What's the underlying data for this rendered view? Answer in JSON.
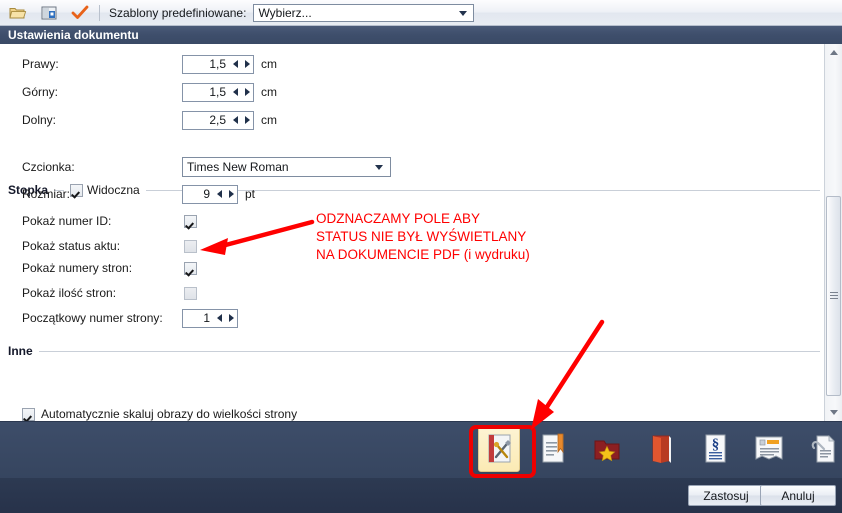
{
  "toolbar": {
    "icons": [
      {
        "name": "open-folder-icon"
      },
      {
        "name": "save-disk-icon"
      },
      {
        "name": "apply-check-icon"
      }
    ],
    "templates_label": "Szablony predefiniowane:",
    "templates_value": "Wybierz...",
    "templates_placeholder": "Wybierz..."
  },
  "header": {
    "title": "Ustawienia dokumentu"
  },
  "margins": [
    {
      "label": "Prawy:",
      "value": "1,5",
      "unit": "cm"
    },
    {
      "label": "Górny:",
      "value": "1,5",
      "unit": "cm"
    },
    {
      "label": "Dolny:",
      "value": "2,5",
      "unit": "cm"
    }
  ],
  "footer_group": {
    "title": "Stopka",
    "visible_label": "Widoczna",
    "visible_checked": true,
    "font_label": "Czcionka:",
    "font_value": "Times New Roman",
    "size_label": "Rozmiar:",
    "size_value": "9",
    "size_unit": "pt",
    "options": [
      {
        "label": "Pokaż numer ID:",
        "checked": true
      },
      {
        "label": "Pokaż status aktu:",
        "checked": false
      },
      {
        "label": "Pokaż numery stron:",
        "checked": true
      },
      {
        "label": "Pokaż ilość stron:",
        "checked": false
      }
    ],
    "start_page_label": "Początkowy numer strony:",
    "start_page_value": "1"
  },
  "other_group": {
    "title": "Inne",
    "autoscale_label": "Automatycznie skaluj obrazy do wielkości strony",
    "autoscale_checked": true
  },
  "dock": {
    "icons": [
      {
        "name": "document-settings-icon",
        "selected": true
      },
      {
        "name": "document-bookmark-icon",
        "selected": false
      },
      {
        "name": "favorites-star-folder-icon",
        "selected": false
      },
      {
        "name": "red-book-icon",
        "selected": false
      },
      {
        "name": "paragraph-section-icon",
        "selected": false
      },
      {
        "name": "document-header-icon",
        "selected": false
      },
      {
        "name": "attachment-document-icon",
        "selected": false
      },
      {
        "name": "open-folder-brown-icon",
        "selected": false
      }
    ]
  },
  "buttons": {
    "apply": "Zastosuj",
    "cancel": "Anuluj"
  },
  "annotation": {
    "line1": "ODZNACZAMY POLE ABY",
    "line2": "STATUS NIE BYŁ WYŚWIETLANY",
    "line3": "NA DOKUMENCIE PDF (i wydruku)",
    "color": "#ff0000"
  },
  "colors": {
    "header_bar": "#3e4e6b",
    "dock_bg": "#36455f",
    "button_bar": "#27324a",
    "annotation_red": "#ff0000",
    "highlight_box": "#ee0000",
    "selected_icon_bg": "#fbeab4"
  }
}
